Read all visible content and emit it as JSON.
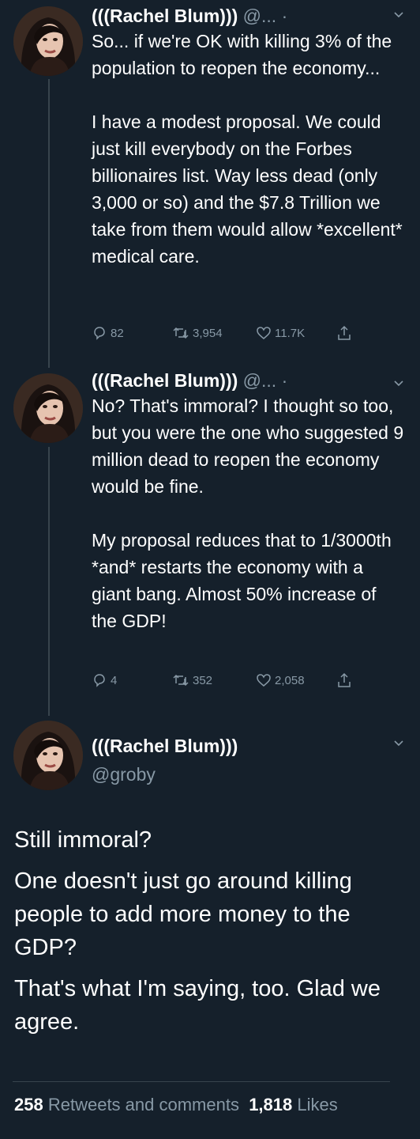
{
  "tweet1": {
    "display_name": "(((Rachel Blum)))",
    "handle": "@... ·",
    "paragraph1": "So... if we're OK with killing 3% of the population to reopen the economy...",
    "paragraph2": "I have a modest proposal. We could just kill everybody on the Forbes billionaires list. Way less dead (only 3,000 or so) and the $7.8 Trillion we take from them would allow *excellent* medical care.",
    "replies": "82",
    "retweets": "3,954",
    "likes": "11.7K"
  },
  "tweet2": {
    "display_name": "(((Rachel Blum)))",
    "handle": "@... ·",
    "paragraph1": "No? That's immoral? I thought so too, but you were the one who suggested 9 million dead to reopen the economy would be fine.",
    "paragraph2": "My proposal reduces that to 1/3000th *and* restarts the economy with a giant bang. Almost 50% increase of the GDP!",
    "replies": "4",
    "retweets": "352",
    "likes": "2,058"
  },
  "tweet3": {
    "display_name": "(((Rachel Blum)))",
    "handle": "@groby",
    "paragraph1": "Still immoral?",
    "paragraph2": "One doesn't just go around killing people to add more money to the GDP?",
    "paragraph3": "That's what I'm saying, too. Glad we agree.",
    "retweets_count": "258",
    "retweets_label": "Retweets and comments",
    "likes_count": "1,818",
    "likes_label": "Likes"
  },
  "colors": {
    "background": "#15202b",
    "secondary_text": "#8899a6",
    "divider": "#38444d"
  },
  "icons": [
    "chevron-down-icon",
    "reply-icon",
    "retweet-icon",
    "like-icon",
    "share-icon"
  ]
}
